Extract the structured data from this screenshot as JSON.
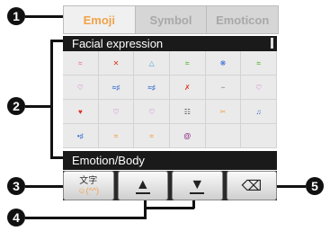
{
  "callouts": [
    "1",
    "2",
    "3",
    "4",
    "5"
  ],
  "tabs": [
    {
      "label": "Emoji",
      "active": true
    },
    {
      "label": "Symbol",
      "active": false
    },
    {
      "label": "Emoticon",
      "active": false
    }
  ],
  "sections": {
    "top": "Facial expression",
    "bottom": "Emotion/Body"
  },
  "emoji_grid": [
    [
      "≈",
      "✕",
      "△",
      "≈",
      "❋",
      "≈"
    ],
    [
      "♡",
      "≈♯",
      "≈♯",
      "✗",
      "~",
      "♡"
    ],
    [
      "♥",
      "♡",
      "♡",
      "☷",
      "✂",
      "♫"
    ],
    [
      "•♯",
      "≈",
      "≈",
      "@",
      "",
      " "
    ]
  ],
  "emoji_colors": [
    [
      "#f07ab0",
      "#e0301e",
      "#4aa3d9",
      "#5cba3c",
      "#3a6fd1",
      "#5cba3c"
    ],
    [
      "#c040c0",
      "#3a6fd1",
      "#3a6fd1",
      "#e0301e",
      "#9a9a9a",
      "#c040c0"
    ],
    [
      "#e0301e",
      "#c040c0",
      "#c040c0",
      "#4a4a4a",
      "#f0a34a",
      "#3a6fd1"
    ],
    [
      "#3a6fd1",
      "#f0a34a",
      "#f0a34a",
      "#8a2f8a",
      "",
      ""
    ]
  ],
  "keys": {
    "mode_kanji": "文字",
    "mode_emoticon": "☺(^^)",
    "page_up": "▲",
    "page_down": "▼",
    "backspace": "⌫"
  }
}
